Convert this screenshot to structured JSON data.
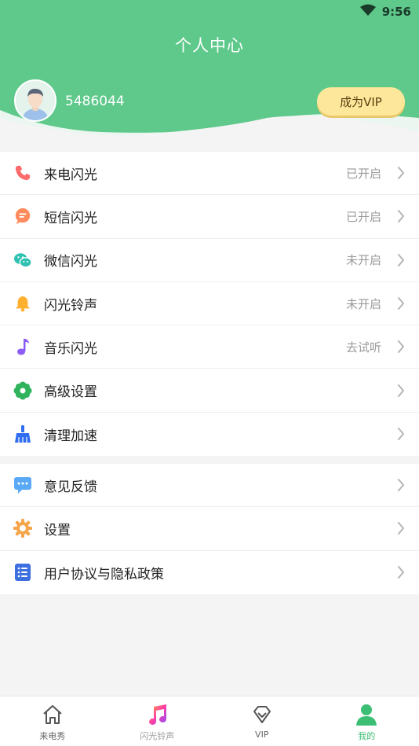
{
  "status_bar": {
    "time": "9:56",
    "wifi_icon": "wifi-icon"
  },
  "header": {
    "title": "个人中心",
    "user_id": "5486044",
    "vip_button": "成为VIP",
    "avatar_icon": "avatar-man-icon"
  },
  "menu_group_1": [
    {
      "label": "来电闪光",
      "status": "已开启",
      "icon": "phone-icon",
      "color": "#ff6b6b"
    },
    {
      "label": "短信闪光",
      "status": "已开启",
      "icon": "message-icon",
      "color": "#ff8a5b"
    },
    {
      "label": "微信闪光",
      "status": "未开启",
      "icon": "wechat-icon",
      "color": "#2fc1b1"
    },
    {
      "label": "闪光铃声",
      "status": "未开启",
      "icon": "bell-icon",
      "color": "#ffb02e"
    },
    {
      "label": "音乐闪光",
      "status": "去试听",
      "icon": "music-note-icon",
      "color": "#8b5cf6"
    },
    {
      "label": "高级设置",
      "status": "",
      "icon": "flower-gear-icon",
      "color": "#2fb35c"
    },
    {
      "label": "清理加速",
      "status": "",
      "icon": "broom-icon",
      "color": "#2f6df2"
    }
  ],
  "menu_group_2": [
    {
      "label": "意见反馈",
      "status": "",
      "icon": "feedback-icon",
      "color": "#5aa9f6"
    },
    {
      "label": "设置",
      "status": "",
      "icon": "gear-icon",
      "color": "#f5a54a"
    },
    {
      "label": "用户协议与隐私政策",
      "status": "",
      "icon": "document-list-icon",
      "color": "#3d6fe0"
    }
  ],
  "tabbar": [
    {
      "label": "来电秀",
      "icon": "home-icon",
      "state": "normal"
    },
    {
      "label": "闪光铃声",
      "icon": "music-icon",
      "state": "dim"
    },
    {
      "label": "VIP",
      "icon": "diamond-icon",
      "state": "normal"
    },
    {
      "label": "我的",
      "icon": "person-icon",
      "state": "active"
    }
  ],
  "colors": {
    "header_green": "#5ec98b",
    "accent_green": "#3cbf74",
    "vip_gold": "#fde79a"
  }
}
